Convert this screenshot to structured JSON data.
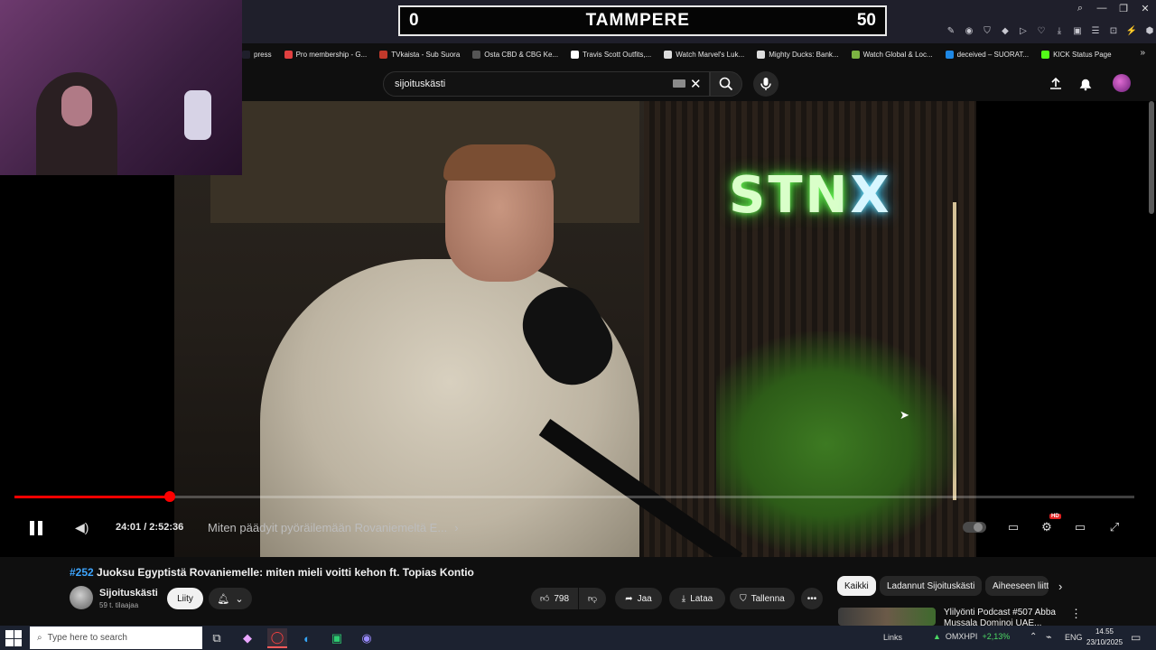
{
  "scoreboard": {
    "left_score": "0",
    "team": "TAMMPERE",
    "right_score": "50"
  },
  "window_controls": {
    "search": "⌕",
    "minimize": "—",
    "restore": "❐",
    "close": "✕"
  },
  "bookmarks": [
    {
      "label": "press",
      "color": "#1f1f2b"
    },
    {
      "label": "Pro membership - G...",
      "color": "#e04040"
    },
    {
      "label": "TVkaista - Sub Suora",
      "color": "#c0392b"
    },
    {
      "label": "Osta CBD & CBG Ke...",
      "color": "#555555"
    },
    {
      "label": "Travis Scott Outfits,...",
      "color": "#ffffff"
    },
    {
      "label": "Watch Marvel's Luk...",
      "color": "#dddddd"
    },
    {
      "label": "Mighty Ducks: Bank...",
      "color": "#dddddd"
    },
    {
      "label": "Watch Global & Loc...",
      "color": "#7cb342"
    },
    {
      "label": "deceived – SUORAT...",
      "color": "#1e88e5"
    },
    {
      "label": "KICK Status Page",
      "color": "#53fc18"
    }
  ],
  "search": {
    "query": "sijoituskästi"
  },
  "player": {
    "time": "24:01 / 2:52:36",
    "chapter": "Miten päädyit pyöräilemään Rovaniemeltä E...",
    "progress": 0.139,
    "hd": "HD"
  },
  "video_overlay": {
    "logo_main": "STN",
    "logo_x": "X"
  },
  "video": {
    "tag": "#252",
    "title": "Juoksu Egyptistä Rovaniemelle: miten mieli voitti kehon ft. Topias Kontio",
    "channel": "Sijoituskästi",
    "subscribers": "59 t. tilaajaa",
    "join": "Liity",
    "likes": "798",
    "share": "Jaa",
    "download": "Lataa",
    "save": "Tallenna"
  },
  "chips": {
    "all": "Kaikki",
    "uploads": "Ladannut Sijoituskästi",
    "related": "Aiheeseen liittyvät"
  },
  "recommendation": {
    "title": "Ylilyönti Podcast #507 Abba Mussala Dominoi UAE..."
  },
  "taskbar": {
    "search_placeholder": "Type here to search",
    "links": "Links",
    "stock_name": "OMXHPI",
    "stock_change": "+2,13%",
    "lang": "ENG",
    "time": "14.55",
    "date": "23/10/2025"
  }
}
